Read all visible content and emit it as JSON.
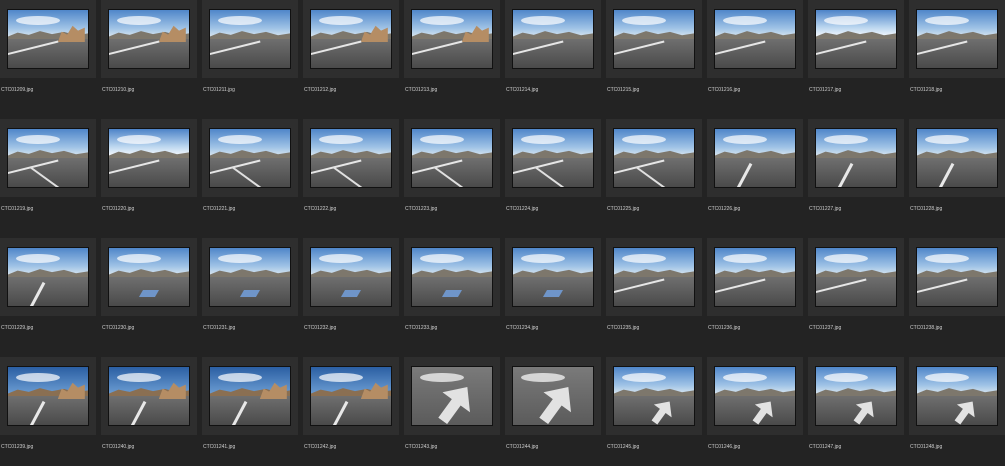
{
  "items": [
    {
      "label": "CTC01209.jpg",
      "scene": "rocks"
    },
    {
      "label": "CTC01210.jpg",
      "scene": "rocks"
    },
    {
      "label": "CTC01211.jpg",
      "scene": "road"
    },
    {
      "label": "CTC01212.jpg",
      "scene": "rocks"
    },
    {
      "label": "CTC01213.jpg",
      "scene": "rocks"
    },
    {
      "label": "CTC01214.jpg",
      "scene": "road"
    },
    {
      "label": "CTC01215.jpg",
      "scene": "road"
    },
    {
      "label": "CTC01216.jpg",
      "scene": "road"
    },
    {
      "label": "CTC01217.jpg",
      "scene": "sunny"
    },
    {
      "label": "CTC01218.jpg",
      "scene": "road"
    },
    {
      "label": "CTC01219.jpg",
      "scene": "lines"
    },
    {
      "label": "CTC01220.jpg",
      "scene": "sunny"
    },
    {
      "label": "CTC01221.jpg",
      "scene": "lines"
    },
    {
      "label": "CTC01222.jpg",
      "scene": "lines"
    },
    {
      "label": "CTC01223.jpg",
      "scene": "lines"
    },
    {
      "label": "CTC01224.jpg",
      "scene": "lines"
    },
    {
      "label": "CTC01225.jpg",
      "scene": "lines"
    },
    {
      "label": "CTC01226.jpg",
      "scene": "stripe"
    },
    {
      "label": "CTC01227.jpg",
      "scene": "stripe"
    },
    {
      "label": "CTC01228.jpg",
      "scene": "stripe"
    },
    {
      "label": "CTC01229.jpg",
      "scene": "stripe"
    },
    {
      "label": "CTC01230.jpg",
      "scene": "handicap"
    },
    {
      "label": "CTC01231.jpg",
      "scene": "handicap"
    },
    {
      "label": "CTC01232.jpg",
      "scene": "handicap"
    },
    {
      "label": "CTC01233.jpg",
      "scene": "handicap"
    },
    {
      "label": "CTC01234.jpg",
      "scene": "handicap"
    },
    {
      "label": "CTC01235.jpg",
      "scene": "road"
    },
    {
      "label": "CTC01236.jpg",
      "scene": "road"
    },
    {
      "label": "CTC01237.jpg",
      "scene": "road"
    },
    {
      "label": "CTC01238.jpg",
      "scene": "road"
    },
    {
      "label": "CTC01239.jpg",
      "scene": "rocky"
    },
    {
      "label": "CTC01240.jpg",
      "scene": "rocky"
    },
    {
      "label": "CTC01241.jpg",
      "scene": "rocky"
    },
    {
      "label": "CTC01242.jpg",
      "scene": "rocky"
    },
    {
      "label": "CTC01243.jpg",
      "scene": "arrow"
    },
    {
      "label": "CTC01244.jpg",
      "scene": "arrow"
    },
    {
      "label": "CTC01245.jpg",
      "scene": "arrowroad"
    },
    {
      "label": "CTC01246.jpg",
      "scene": "arrowroad"
    },
    {
      "label": "CTC01247.jpg",
      "scene": "arrowroad"
    },
    {
      "label": "CTC01248.jpg",
      "scene": "arrowroad"
    }
  ]
}
